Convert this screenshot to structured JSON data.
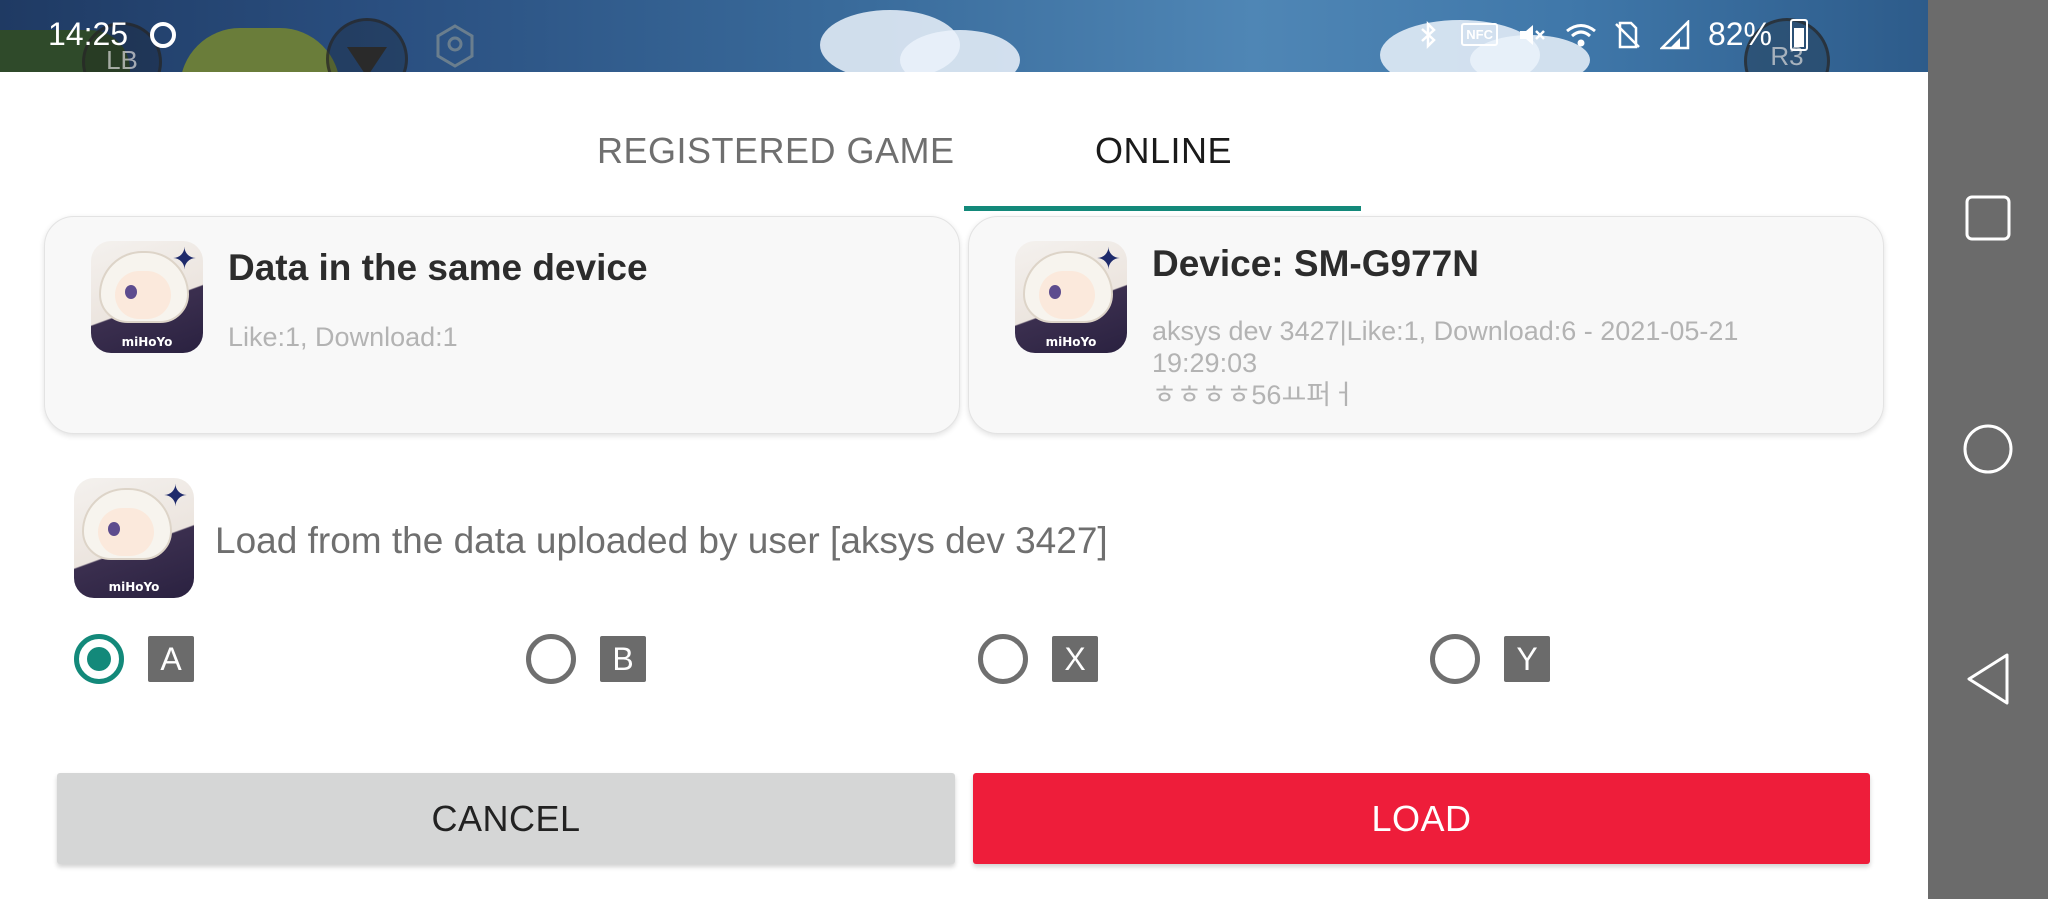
{
  "status_bar": {
    "time": "14:25",
    "battery": "82%",
    "nfc_label": "NFC",
    "hud": {
      "lb": "LB",
      "r3": "R3"
    }
  },
  "tabs": [
    {
      "label": "REGISTERED GAME",
      "active": false
    },
    {
      "label": "ONLINE",
      "active": true
    }
  ],
  "cards": [
    {
      "title": "Data in the same device",
      "subtitle": "Like:1, Download:1",
      "icon_label": "miHoYo"
    },
    {
      "title": "Device: SM-G977N",
      "subtitle_line1": "aksys dev 3427|Like:1, Download:6 - 2021-05-21",
      "subtitle_line2": "19:29:03",
      "subtitle_line3": "ㅎㅎㅎㅎ56ㅛ퍼ㅓ",
      "icon_label": "miHoYo"
    }
  ],
  "load_source": {
    "text": "Load from the data uploaded by user [aksys dev 3427]",
    "icon_label": "miHoYo"
  },
  "button_options": [
    {
      "key": "A",
      "selected": true
    },
    {
      "key": "B",
      "selected": false
    },
    {
      "key": "X",
      "selected": false
    },
    {
      "key": "Y",
      "selected": false
    }
  ],
  "actions": {
    "cancel_label": "CANCEL",
    "load_label": "LOAD"
  },
  "colors": {
    "accent": "#13897a",
    "load_button": "#ee1d3a",
    "cancel_button": "#d5d6d6",
    "nav_bar": "#6b6b6b"
  },
  "icons": [
    "bluetooth-icon",
    "nfc-icon",
    "mute-icon",
    "wifi-icon",
    "no-sim-icon",
    "signal-icon",
    "battery-icon",
    "recents-icon",
    "home-icon",
    "back-icon"
  ]
}
